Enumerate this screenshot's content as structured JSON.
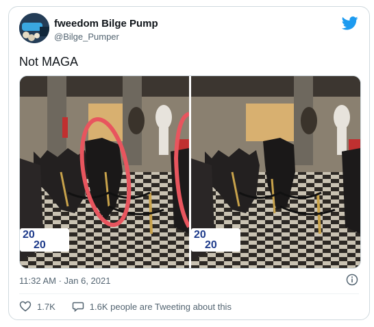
{
  "author": {
    "display_name": "fweedom Bilge Pump",
    "handle": "@Bilge_Pumper"
  },
  "tweet": {
    "text": "Not MAGA",
    "timestamp": "11:32 AM · Jan 6, 2021"
  },
  "media": {
    "logo_line1": "20",
    "logo_line2": "20"
  },
  "actions": {
    "likes": "1.7K",
    "tweeting": "1.6K people are Tweeting about this"
  },
  "colors": {
    "brand": "#1d9bf0",
    "annotation": "#e8555e"
  }
}
